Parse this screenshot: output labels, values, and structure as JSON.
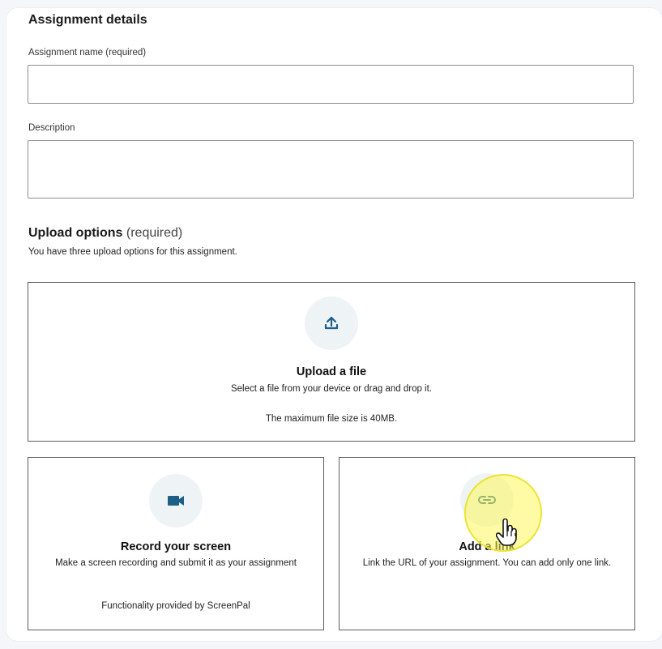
{
  "assignment": {
    "heading": "Assignment details",
    "name_label": "Assignment name (required)",
    "name_value": "",
    "description_label": "Description",
    "description_value": ""
  },
  "upload": {
    "heading": "Upload options",
    "heading_suffix": "(required)",
    "subtitle": "You have three upload options for this assignment."
  },
  "options": {
    "file": {
      "icon": "upload-icon",
      "title": "Upload a file",
      "description": "Select a file from your device or drag and drop it.",
      "note": "The maximum file size is 40MB."
    },
    "record": {
      "icon": "video-camera-icon",
      "title": "Record your screen",
      "description": "Make a screen recording and submit it as your assignment",
      "note": "Functionality provided by ScreenPal"
    },
    "link": {
      "icon": "link-icon",
      "title": "Add a link",
      "description": "Link the URL of your assignment. You can add only one link."
    }
  },
  "colors": {
    "accent": "#1d5f86",
    "icon_bg": "#eef3f5",
    "cursor_highlight": "#fff85a"
  }
}
